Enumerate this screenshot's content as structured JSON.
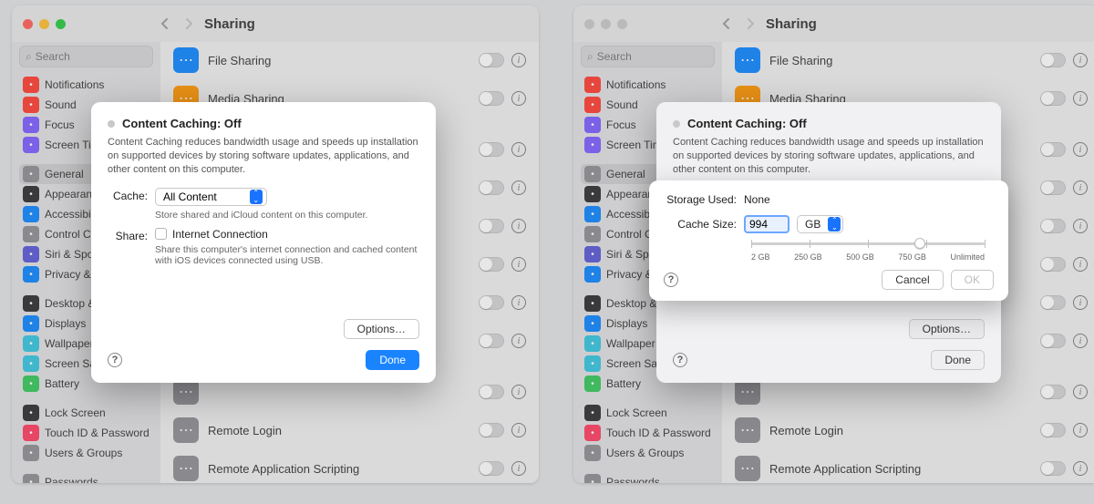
{
  "header": {
    "title": "Sharing"
  },
  "search": {
    "placeholder": "Search"
  },
  "sidebar": {
    "items_a": [
      {
        "id": "notifications",
        "label": "Notifications",
        "color": "#ff3b30"
      },
      {
        "id": "sound",
        "label": "Sound",
        "color": "#ff3b30"
      },
      {
        "id": "focus",
        "label": "Focus",
        "color": "#7a5cff"
      },
      {
        "id": "screentime",
        "label": "Screen Time",
        "color": "#7a5cff",
        "trunc": "Screen Time"
      }
    ],
    "items_b": [
      {
        "id": "general",
        "label": "General",
        "color": "#8e8e93",
        "selected": true
      },
      {
        "id": "appearance",
        "label": "Appearance",
        "color": "#2d2d2f"
      },
      {
        "id": "accessibility",
        "label": "Accessibility",
        "color": "#0a84ff"
      },
      {
        "id": "controlcenter",
        "label": "Control Center",
        "color": "#8e8e93",
        "trunc": "Control Cent"
      },
      {
        "id": "siri",
        "label": "Siri & Spotlight",
        "color": "#5856d6",
        "trunc": "Siri & Spotlig"
      },
      {
        "id": "privacy",
        "label": "Privacy & Security",
        "color": "#0a84ff",
        "trunc": "Privacy & Se"
      }
    ],
    "items_c": [
      {
        "id": "desktop",
        "label": "Desktop & Dock",
        "color": "#2d2d2f",
        "trunc": "Desktop & D"
      },
      {
        "id": "displays",
        "label": "Displays",
        "color": "#0a84ff"
      },
      {
        "id": "wallpaper",
        "label": "Wallpaper",
        "color": "#34c5e0"
      },
      {
        "id": "screensaver",
        "label": "Screen Saver",
        "color": "#34c5e0",
        "trunc": "Screen Saver"
      },
      {
        "id": "battery",
        "label": "Battery",
        "color": "#34c759"
      }
    ],
    "items_d": [
      {
        "id": "lockscreen",
        "label": "Lock Screen",
        "color": "#2d2d2f"
      },
      {
        "id": "touchid",
        "label": "Touch ID & Password",
        "color": "#ff3b60"
      },
      {
        "id": "users",
        "label": "Users & Groups",
        "color": "#8e8e93"
      }
    ],
    "items_e": [
      {
        "id": "passwords",
        "label": "Passwords",
        "color": "#8e8e93"
      }
    ]
  },
  "share_rows": [
    {
      "id": "filesharing",
      "label": "File Sharing",
      "color": "#0a84ff"
    },
    {
      "id": "mediasharing",
      "label": "Media Sharing",
      "color": "#ff9500"
    },
    {
      "id": "gap1",
      "gap": true
    },
    {
      "id": "hidden1",
      "label": " ",
      "color": "#8e8e93"
    },
    {
      "id": "hidden2",
      "label": " ",
      "color": "#8e8e93"
    },
    {
      "id": "hidden3",
      "label": " ",
      "color": "#8e8e93"
    },
    {
      "id": "hidden4",
      "label": " ",
      "color": "#8e8e93"
    },
    {
      "id": "hidden5",
      "label": " ",
      "color": "#8e8e93"
    },
    {
      "id": "hidden6",
      "label": " ",
      "color": "#8e8e93"
    },
    {
      "id": "gap2",
      "gap": true
    },
    {
      "id": "remotemgmt",
      "label": " ",
      "color": "#8e8e93"
    },
    {
      "id": "remotelogin",
      "label": "Remote Login",
      "color": "#8e8e93"
    },
    {
      "id": "remoteapp",
      "label": "Remote Application Scripting",
      "color": "#8e8e93"
    }
  ],
  "sheet": {
    "title": "Content Caching: Off",
    "desc": "Content Caching reduces bandwidth usage and speeds up installation on supported devices by storing software updates, applications, and other content on this computer.",
    "cache": {
      "label": "Cache:",
      "value": "All Content",
      "hint": "Store shared and iCloud content on this computer."
    },
    "share": {
      "label": "Share:",
      "checkbox": "Internet Connection",
      "hint": "Share this computer's internet connection and cached content with iOS devices connected using USB."
    },
    "options": "Options…",
    "done": "Done"
  },
  "pop": {
    "storage_label": "Storage Used:",
    "storage_value": "None",
    "size_label": "Cache Size:",
    "size_value": "994",
    "unit": "GB",
    "ticks": [
      "2 GB",
      "250 GB",
      "500 GB",
      "750 GB",
      "Unlimited"
    ],
    "cancel": "Cancel",
    "ok": "OK"
  }
}
